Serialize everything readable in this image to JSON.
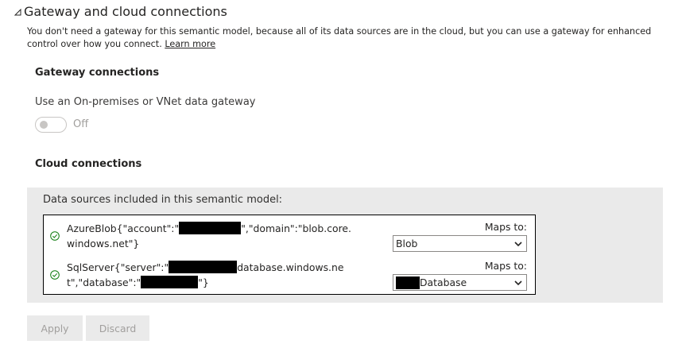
{
  "section": {
    "title": "Gateway and cloud connections",
    "description": "You don't need a gateway for this semantic model, because all of its data sources are in the cloud, but you can use a gateway for enhanced control over how you connect.",
    "learn_more": "Learn more"
  },
  "gateway": {
    "heading": "Gateway connections",
    "toggle_label": "Use an On-premises or VNet data gateway",
    "toggle_state": "Off"
  },
  "cloud": {
    "heading": "Cloud connections",
    "caption": "Data sources included in this semantic model:",
    "rows": [
      {
        "source_part1": "AzureBlob{\"account\":\"",
        "source_part2": "\",\"domain\":\"blob.core.windows.net\"}",
        "maps_to_label": "Maps to:",
        "selected": "Blob"
      },
      {
        "source_part1": "SqlServer{\"server\":\"",
        "source_part2": "database.windows.net\",\"database\":\"",
        "source_part3": "\"}",
        "maps_to_label": "Maps to:",
        "selected": "Database"
      }
    ]
  },
  "actions": {
    "apply": "Apply",
    "discard": "Discard"
  },
  "colors": {
    "check": "#107c10",
    "panel": "#eaeaea",
    "redaction": "#000000"
  }
}
